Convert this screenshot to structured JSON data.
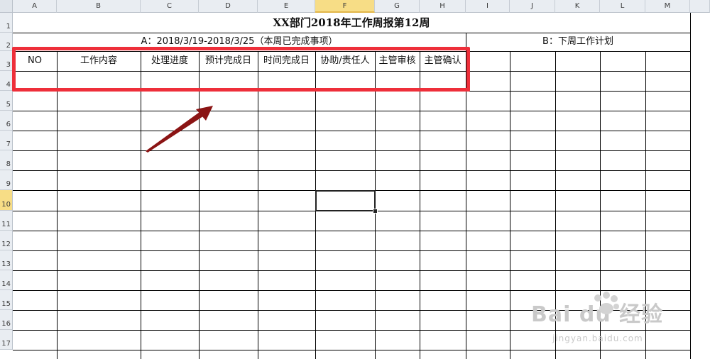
{
  "columns": [
    "A",
    "B",
    "C",
    "D",
    "E",
    "F",
    "G",
    "H",
    "I",
    "J",
    "K",
    "L",
    "M"
  ],
  "rows": [
    "1",
    "2",
    "3",
    "4",
    "5",
    "6",
    "7",
    "8",
    "9",
    "10",
    "11",
    "12",
    "13",
    "14",
    "15",
    "16",
    "17"
  ],
  "active_column": "F",
  "active_row": "10",
  "title": "XX部门2018年工作周报第12周",
  "section_a": "A：2018/3/19-2018/3/25（本周已完成事项）",
  "section_b": "B：下周工作计划",
  "headers": [
    "NO",
    "工作内容",
    "处理进度",
    "预计完成日",
    "时间完成日",
    "协助/责任人",
    "主管审核",
    "主管确认"
  ],
  "watermark": {
    "logo": "Bai du 经验",
    "url": "jingyan.baidu.com"
  },
  "colors": {
    "highlight_box": "#ee2f3a",
    "arrow": "#8b1414",
    "header_bg": "#e9edf2",
    "active_header_bg": "#f7dd86"
  }
}
